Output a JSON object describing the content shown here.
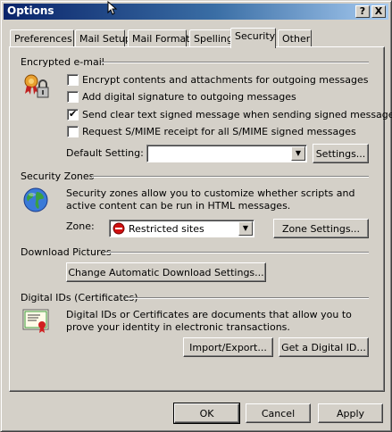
{
  "window": {
    "title": "Options",
    "help_button": "?",
    "close_button": "X"
  },
  "tabs": [
    {
      "label": "Preferences",
      "active": false
    },
    {
      "label": "Mail Setup",
      "active": false
    },
    {
      "label": "Mail Format",
      "active": false
    },
    {
      "label": "Spelling",
      "active": false
    },
    {
      "label": "Security",
      "active": true
    },
    {
      "label": "Other",
      "active": false
    }
  ],
  "encrypted": {
    "heading": "Encrypted e-mail",
    "icon": "certificate-lock-icon",
    "options": [
      {
        "label": "Encrypt contents and attachments for outgoing messages",
        "checked": false
      },
      {
        "label": "Add digital signature to outgoing messages",
        "checked": false
      },
      {
        "label": "Send clear text signed message when sending signed messages",
        "checked": true
      },
      {
        "label": "Request S/MIME receipt for all S/MIME signed messages",
        "checked": false
      }
    ],
    "default_setting_label": "Default Setting:",
    "default_setting_value": "",
    "settings_button": "Settings..."
  },
  "zones": {
    "heading": "Security Zones",
    "icon": "globe-icon",
    "description": "Security zones allow you to customize whether scripts and active content can be run in HTML messages.",
    "zone_label": "Zone:",
    "zone_value": "Restricted sites",
    "zone_value_icon": "restricted-icon",
    "zone_settings_button": "Zone Settings..."
  },
  "pictures": {
    "heading": "Download Pictures",
    "change_button": "Change Automatic Download Settings..."
  },
  "ids": {
    "heading": "Digital IDs (Certificates)",
    "icon": "certificate-icon",
    "description": "Digital IDs or Certificates are documents that allow you to prove your identity in electronic transactions.",
    "import_button": "Import/Export...",
    "get_button": "Get a Digital ID..."
  },
  "footer": {
    "ok": "OK",
    "cancel": "Cancel",
    "apply": "Apply"
  },
  "colors": {
    "title_start": "#0a246a",
    "title_end": "#a6caf0",
    "face": "#d4d0c8"
  }
}
